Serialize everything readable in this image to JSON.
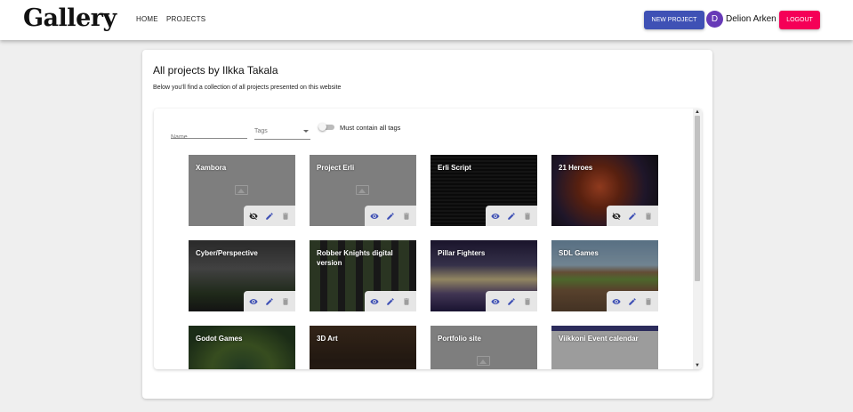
{
  "header": {
    "logo": "Gallery",
    "nav": [
      "HOME",
      "PROJECTS"
    ],
    "new_project_label": "NEW PROJECT",
    "avatar_letter": "D",
    "username": "Delion Arken",
    "logout_label": "LOGOUT"
  },
  "main": {
    "title": "All projects by Ilkka Takala",
    "subtitle": "Below you'll find a collection of all projects presented on this website"
  },
  "filters": {
    "name_placeholder": "Name",
    "tags_placeholder": "Tags",
    "must_contain_label": "Must contain all tags",
    "must_contain_all_tags": false
  },
  "projects": [
    {
      "title": "Xambora",
      "style": "placeholder",
      "visibility": "hidden"
    },
    {
      "title": "Project Erli",
      "style": "placeholder",
      "visibility": "visible"
    },
    {
      "title": "Erli Script",
      "style": "code",
      "visibility": "visible"
    },
    {
      "title": "21 Heroes",
      "style": "heroes",
      "visibility": "hidden"
    },
    {
      "title": "Cyber/Perspective",
      "style": "cyber",
      "visibility": "visible"
    },
    {
      "title": "Robber Knights digital version",
      "style": "robber",
      "visibility": "visible"
    },
    {
      "title": "Pillar Fighters",
      "style": "pillar",
      "visibility": "visible"
    },
    {
      "title": "SDL Games",
      "style": "sdl",
      "visibility": "visible"
    },
    {
      "title": "Godot Games",
      "style": "godot",
      "visibility": "visible"
    },
    {
      "title": "3D Art",
      "style": "3d",
      "visibility": "visible"
    },
    {
      "title": "Portfolio site",
      "style": "placeholder",
      "visibility": "visible"
    },
    {
      "title": "Viikkoni Event calendar",
      "style": "event",
      "visibility": "visible"
    }
  ],
  "colors": {
    "primary": "#3f51b5",
    "secondary": "#f50057",
    "avatar": "#673ab7"
  }
}
